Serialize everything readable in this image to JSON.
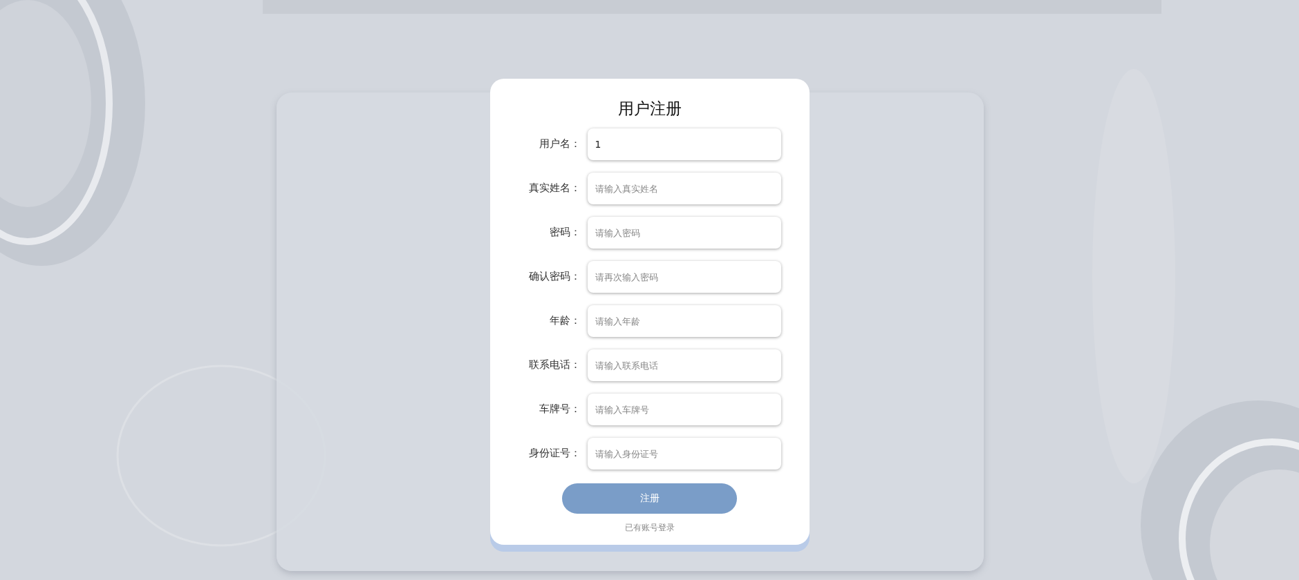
{
  "form": {
    "title": "用户注册",
    "fields": [
      {
        "label": "用户名：",
        "value": "1"
      },
      {
        "label": "真实姓名：",
        "placeholder": "请输入真实姓名"
      },
      {
        "label": "密码：",
        "placeholder": "请输入密码"
      },
      {
        "label": "确认密码：",
        "placeholder": "请再次输入密码"
      },
      {
        "label": "年龄：",
        "placeholder": "请输入年龄"
      },
      {
        "label": "联系电话：",
        "placeholder": "请输入联系电话"
      },
      {
        "label": "车牌号：",
        "placeholder": "请输入车牌号"
      },
      {
        "label": "身份证号：",
        "placeholder": "请输入身份证号"
      }
    ],
    "submit": "注册",
    "login_link": "已有账号登录"
  }
}
